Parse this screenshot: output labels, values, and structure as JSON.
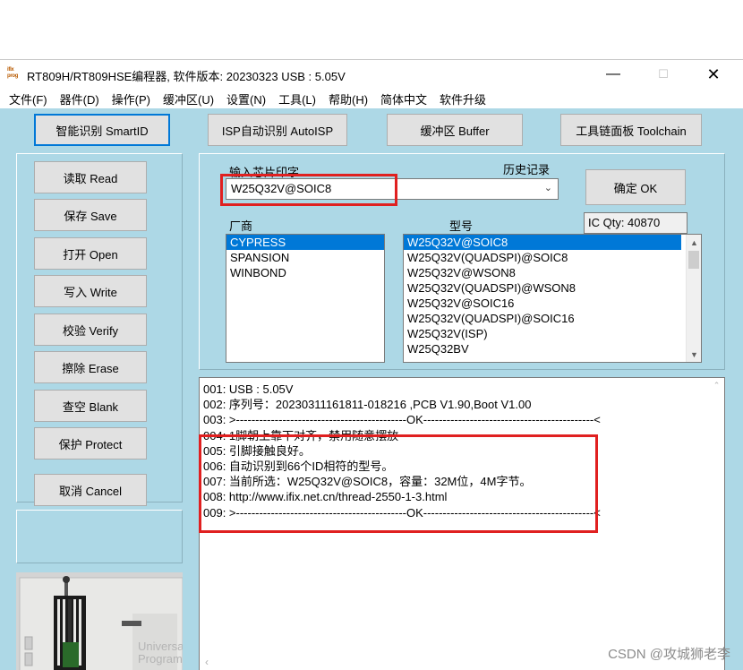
{
  "window": {
    "icon_text": "ifix prog",
    "title": "RT809H/RT809HSE编程器, 软件版本: 20230323  USB : 5.05V",
    "controls": {
      "minimize": "—",
      "maximize": "☐",
      "close": "✕"
    }
  },
  "menu": [
    "文件(F)",
    "器件(D)",
    "操作(P)",
    "缓冲区(U)",
    "设置(N)",
    "工具(L)",
    "帮助(H)",
    "简体中文",
    "软件升级"
  ],
  "toolbar": {
    "smartid": "智能识别 SmartID",
    "autoisp": "ISP自动识别 AutoISP",
    "buffer": "缓冲区 Buffer",
    "toolchain": "工具链面板 Toolchain"
  },
  "actions": {
    "read": "读取 Read",
    "save": "保存 Save",
    "open": "打开 Open",
    "write": "写入 Write",
    "verify": "校验 Verify",
    "erase": "擦除 Erase",
    "blank": "查空 Blank",
    "protect": "保护 Protect",
    "cancel": "取消 Cancel"
  },
  "chip_panel": {
    "input_label": "输入芯片印字",
    "history_label": "历史记录",
    "input_value": "W25Q32V@SOIC8",
    "confirm": "确定 OK",
    "ic_qty": "IC Qty: 40870",
    "vendor_label": "厂商",
    "model_label": "型号",
    "vendors": [
      "CYPRESS",
      "SPANSION",
      "WINBOND"
    ],
    "selected_vendor_index": 0,
    "models": [
      "W25Q32V@SOIC8",
      "W25Q32V(QUADSPI)@SOIC8",
      "W25Q32V@WSON8",
      "W25Q32V(QUADSPI)@WSON8",
      "W25Q32V@SOIC16",
      "W25Q32V(QUADSPI)@SOIC16",
      "W25Q32V(ISP)",
      "W25Q32BV"
    ],
    "selected_model_index": 0
  },
  "log": [
    "001:  USB : 5.05V",
    "002:  序列号：20230311161811-018216  ,PCB V1.90,Boot V1.00",
    "003:  >--------------------------------------------OK--------------------------------------------<",
    "004:  1脚朝上靠下对齐，禁用随意摆放",
    "005:  引脚接触良好。",
    "006:  自动识别到66个ID相符的型号。",
    "007:  当前所选：W25Q32V@SOIC8，容量：32M位，4M字节。",
    "008:  http://www.ifix.net.cn/thread-2550-1-3.html",
    "009:  >--------------------------------------------OK--------------------------------------------<"
  ],
  "device_label": "Universal Programmer",
  "watermark": "CSDN @攻城狮老李",
  "colors": {
    "client_bg": "#add8e6",
    "selection": "#0078d7",
    "highlight_box": "#e02020"
  }
}
